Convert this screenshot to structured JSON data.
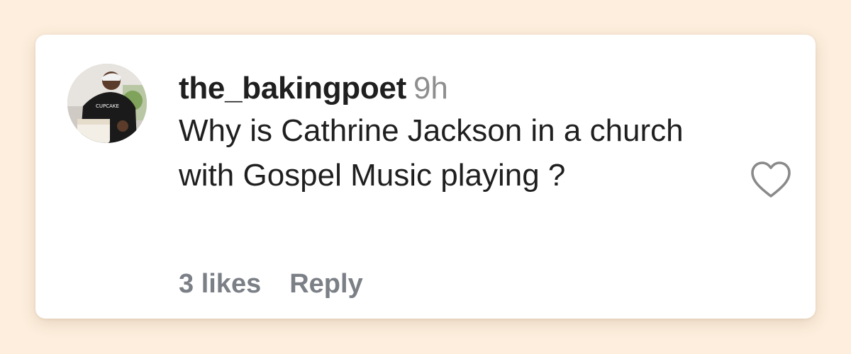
{
  "comment": {
    "username": "the_bakingpoet",
    "timestamp": "9h",
    "text": "Why is Cathrine Jackson in a church with Gospel Music playing ?",
    "likes_label": "3 likes",
    "reply_label": "Reply"
  },
  "icons": {
    "like": "heart-outline-icon"
  },
  "colors": {
    "background": "#fdeedd",
    "card": "#ffffff",
    "text": "#1f1f1f",
    "muted": "#8e8e8e",
    "footer": "#7b7f86"
  }
}
